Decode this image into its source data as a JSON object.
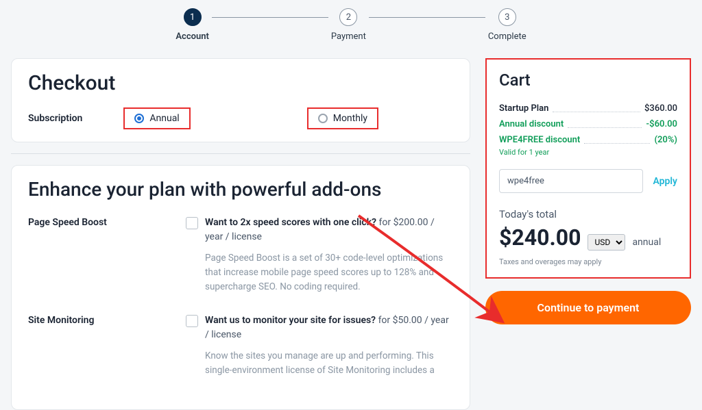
{
  "stepper": {
    "steps": [
      {
        "num": "1",
        "label": "Account",
        "active": true
      },
      {
        "num": "2",
        "label": "Payment",
        "active": false
      },
      {
        "num": "3",
        "label": "Complete",
        "active": false
      }
    ]
  },
  "checkout": {
    "title": "Checkout",
    "subscription_label": "Subscription",
    "options": {
      "annual": "Annual",
      "monthly": "Monthly"
    },
    "selected": "annual"
  },
  "addons": {
    "title": "Enhance your plan with powerful add-ons",
    "items": [
      {
        "name": "Page Speed Boost",
        "question": "Want to 2x speed scores with one click?",
        "price": "for $200.00 / year / license",
        "desc": "Page Speed Boost is a set of 30+ code-level optimizations that increase mobile page speed scores up to 128% and supercharge SEO. No coding required."
      },
      {
        "name": "Site Monitoring",
        "question": "Want us to monitor your site for issues?",
        "price": "for $50.00 / year / license",
        "desc": "Know the sites you manage are up and performing. This single-environment license of Site Monitoring includes a"
      }
    ]
  },
  "cart": {
    "title": "Cart",
    "items": [
      {
        "name": "Startup Plan",
        "value": "$360.00",
        "green": false
      },
      {
        "name": "Annual discount",
        "value": "-$60.00",
        "green": true
      },
      {
        "name": "WPE4FREE discount",
        "value": "(20%)",
        "green": true
      }
    ],
    "valid_note": "Valid for 1 year",
    "promo_value": "wpe4free",
    "apply_label": "Apply",
    "total_label": "Today's total",
    "total_amount": "$240.00",
    "currency": "USD",
    "period": "annual",
    "tax_note": "Taxes and overages may apply"
  },
  "cta_label": "Continue to payment"
}
